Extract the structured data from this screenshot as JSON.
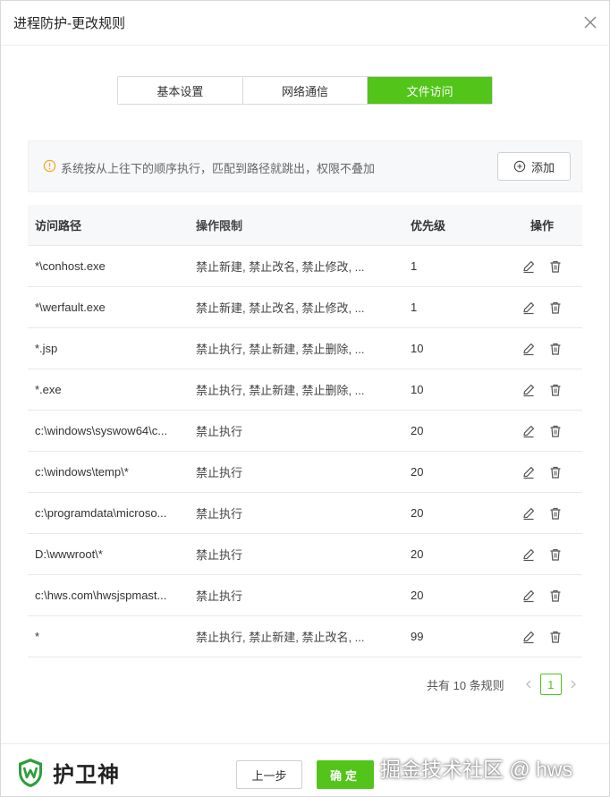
{
  "dialog": {
    "title": "进程防护-更改规则"
  },
  "tabs": [
    {
      "label": "基本设置",
      "active": false
    },
    {
      "label": "网络通信",
      "active": false
    },
    {
      "label": "文件访问",
      "active": true
    }
  ],
  "notice": {
    "message": "系统按从上往下的顺序执行，匹配到路径就跳出，权限不叠加",
    "icon": "warning-circle-icon"
  },
  "add_button": {
    "label": "添加",
    "icon": "plus-circle-icon"
  },
  "table": {
    "columns": [
      "访问路径",
      "操作限制",
      "优先级",
      "操作"
    ],
    "rows": [
      {
        "path": "*\\conhost.exe",
        "limits": "禁止新建, 禁止改名, 禁止修改, ...",
        "priority": "1"
      },
      {
        "path": "*\\werfault.exe",
        "limits": "禁止新建, 禁止改名, 禁止修改, ...",
        "priority": "1"
      },
      {
        "path": "*.jsp",
        "limits": "禁止执行, 禁止新建, 禁止删除, ...",
        "priority": "10"
      },
      {
        "path": "*.exe",
        "limits": "禁止执行, 禁止新建, 禁止删除, ...",
        "priority": "10"
      },
      {
        "path": "c:\\windows\\syswow64\\c...",
        "limits": "禁止执行",
        "priority": "20"
      },
      {
        "path": "c:\\windows\\temp\\*",
        "limits": "禁止执行",
        "priority": "20"
      },
      {
        "path": "c:\\programdata\\microso...",
        "limits": "禁止执行",
        "priority": "20"
      },
      {
        "path": "D:\\wwwroot\\*",
        "limits": "禁止执行",
        "priority": "20"
      },
      {
        "path": "c:\\hws.com\\hwsjspmast...",
        "limits": "禁止执行",
        "priority": "20"
      },
      {
        "path": "*",
        "limits": "禁止执行, 禁止新建, 禁止改名, ...",
        "priority": "99"
      }
    ]
  },
  "pagination": {
    "total_text": "共有 10 条规则",
    "current_page": "1"
  },
  "footer": {
    "brand": "护卫神",
    "prev_label": "上一步",
    "ok_label": "确定",
    "watermark": "掘金技术社区 @ hws"
  },
  "colors": {
    "accent": "#52c41a",
    "warning": "#f5a623"
  }
}
